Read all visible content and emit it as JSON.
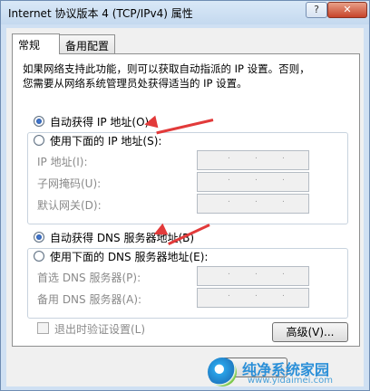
{
  "window": {
    "title": "Internet 协议版本 4 (TCP/IPv4) 属性",
    "help_label": "?",
    "close_label": "✕"
  },
  "tabs": [
    {
      "label": "常规",
      "selected": true
    },
    {
      "label": "备用配置",
      "selected": false
    }
  ],
  "description": {
    "line1": "如果网络支持此功能，则可以获取自动指派的 IP 设置。否则，",
    "line2": "您需要从网络系统管理员处获得适当的 IP 设置。"
  },
  "ip_section": {
    "auto_label": "自动获得 IP 地址(O)",
    "manual_label": "使用下面的 IP 地址(S):",
    "fields": [
      {
        "label": "IP 地址(I):"
      },
      {
        "label": "子网掩码(U):"
      },
      {
        "label": "默认网关(D):"
      }
    ]
  },
  "dns_section": {
    "auto_label": "自动获得 DNS 服务器地址(B)",
    "manual_label": "使用下面的 DNS 服务器地址(E):",
    "fields": [
      {
        "label": "首选 DNS 服务器(P):"
      },
      {
        "label": "备用 DNS 服务器(A):"
      }
    ]
  },
  "validate_label": "退出时验证设置(L)",
  "advanced_label": "高级(V)...",
  "watermark": {
    "title": "纯净系统家园",
    "url": "www.yidaimei.com"
  },
  "colors": {
    "annotation_arrow": "#e23a3a",
    "selected_radio": "#1f4f9c"
  }
}
